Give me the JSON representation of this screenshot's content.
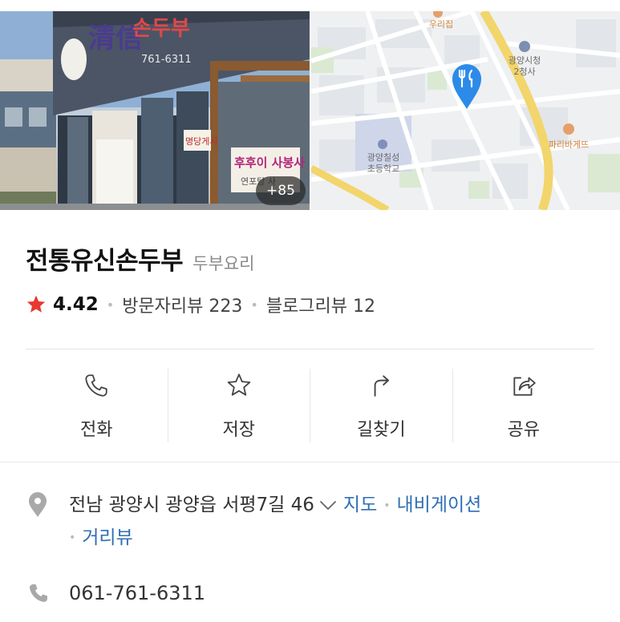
{
  "hero": {
    "photo_count": "+85",
    "map_labels": {
      "restaurant_top": "우리집",
      "city_hall": "광양시청\n2청사",
      "school": "광양칠성\n초등학교",
      "bakery": "파리바게뜨"
    }
  },
  "place": {
    "name": "전통유신손두부",
    "category": "두부요리",
    "rating": "4.42",
    "visitor_review": "방문자리뷰 223",
    "blog_review": "블로그리뷰 12"
  },
  "actions": [
    {
      "label": "전화",
      "icon": "phone-icon"
    },
    {
      "label": "저장",
      "icon": "star-icon"
    },
    {
      "label": "길찾기",
      "icon": "directions-icon"
    },
    {
      "label": "공유",
      "icon": "share-icon"
    }
  ],
  "address": {
    "text": "전남 광양시 광양읍 서평7길 46",
    "links": {
      "map": "지도",
      "navigation": "내비게이션",
      "street_view": "거리뷰"
    }
  },
  "phone": "061-761-6311",
  "colors": {
    "star": "#e8382f",
    "link": "#2f6fb3",
    "map_pin": "#2c8be8"
  }
}
